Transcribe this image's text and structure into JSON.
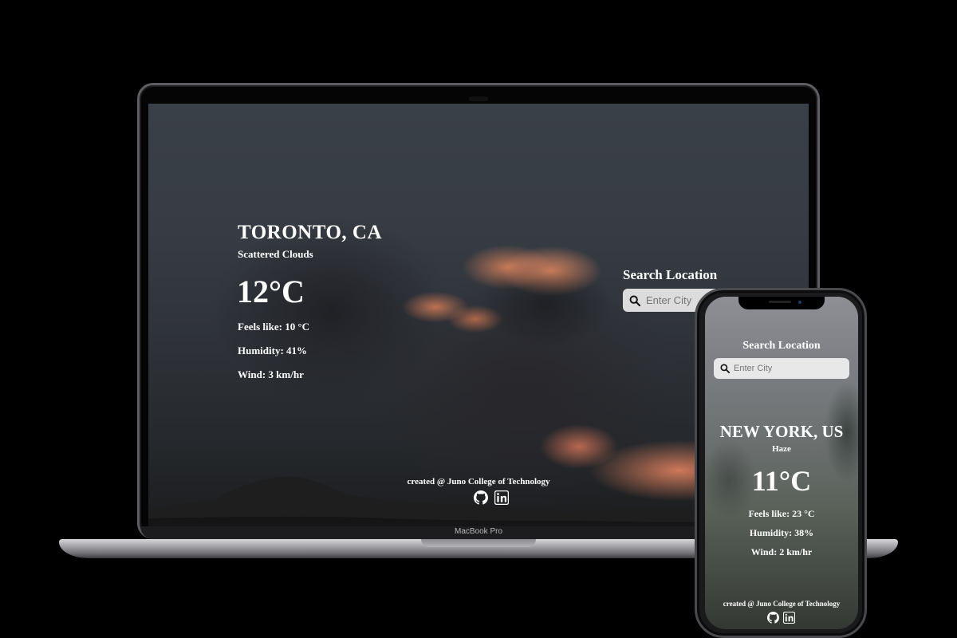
{
  "desktop": {
    "device_label": "MacBook Pro",
    "city": "TORONTO, CA",
    "description": "Scattered Clouds",
    "temperature": "12°C",
    "feels_like": "Feels like: 10 °C",
    "humidity": "Humidity: 41%",
    "wind": "Wind: 3 km/hr",
    "search": {
      "title": "Search Location",
      "placeholder": "Enter City"
    },
    "footer": "created @ Juno College of Technology",
    "icons": [
      "github-icon",
      "linkedin-icon"
    ]
  },
  "mobile": {
    "city": "NEW YORK, US",
    "description": "Haze",
    "temperature": "11°C",
    "feels_like": "Feels like: 23 °C",
    "humidity": "Humidity: 38%",
    "wind": "Wind: 2 km/hr",
    "search": {
      "title": "Search Location",
      "placeholder": "Enter City"
    },
    "footer": "created @ Juno College of Technology",
    "icons": [
      "github-icon",
      "linkedin-icon"
    ]
  },
  "colors": {
    "background": "#000000",
    "text": "#ffffff",
    "search_box": "#dcdcdc"
  }
}
